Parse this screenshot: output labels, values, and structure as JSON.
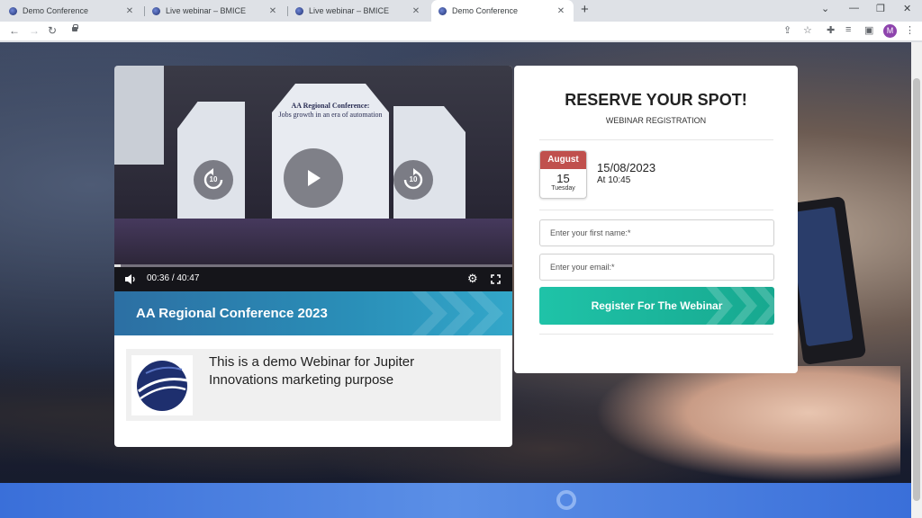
{
  "browser": {
    "tabs": [
      {
        "label": "Demo Conference",
        "active": false
      },
      {
        "label": "Live webinar – BMICE",
        "active": false
      },
      {
        "label": "Live webinar – BMICE",
        "active": false
      },
      {
        "label": "Demo Conference",
        "active": true
      }
    ],
    "new_tab_glyph": "+",
    "close_glyph": "✕",
    "profile_initial": "M"
  },
  "video": {
    "stage_caption_title": "AA Regional Conference:",
    "stage_caption_sub": "Jobs growth in an era of automation",
    "rewind_label": "10",
    "forward_label": "10",
    "current_time": "00:36",
    "separator": "/",
    "duration": "40:47",
    "progress_fraction": 0.015
  },
  "event": {
    "title": "AA Regional Conference 2023",
    "description": "This is a demo Webinar for Jupiter Innovations marketing purpose"
  },
  "registration": {
    "heading": "RESERVE YOUR SPOT!",
    "subheading": "WEBINAR REGISTRATION",
    "calendar_month": "August",
    "calendar_day": "15",
    "calendar_weekday": "Tuesday",
    "date": "15/08/2023",
    "time": "At 10:45",
    "first_name_placeholder": "Enter your first name:*",
    "email_placeholder": "Enter your email:*",
    "submit_label": "Register For The Webinar"
  },
  "colors": {
    "accent_teal": "#1fc3a8",
    "calendar_red": "#c0504d",
    "title_blue": "#2a8fb8"
  }
}
